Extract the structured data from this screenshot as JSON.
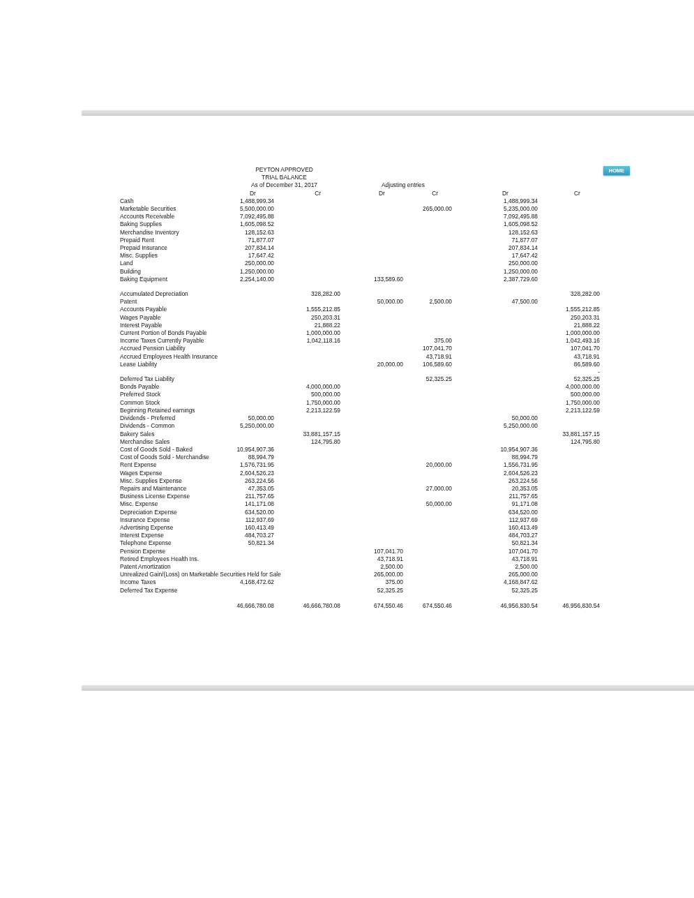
{
  "home_button": "HOME",
  "header": {
    "company": "PEYTON APPROVED",
    "title": "TRIAL BALANCE",
    "date": "As of December 31, 2017",
    "adjusting_heading": "Adjusting entries"
  },
  "column_headings": [
    "Dr",
    "Cr",
    "Dr",
    "Cr",
    "Dr",
    "Cr"
  ],
  "rows": [
    {
      "kind": "account",
      "label": "Cash",
      "dr": "1,488,999.34",
      "column_5": "1,488,999.34"
    },
    {
      "kind": "account",
      "label": "Marketable Securities",
      "dr": "5,500,000.00",
      "adj_cr": "265,000.00",
      "column_5": "5,235,000.00"
    },
    {
      "kind": "account",
      "label": "Accounts Receivable",
      "dr": "7,092,495.88",
      "column_5": "7,092,495.88"
    },
    {
      "kind": "account",
      "label": "Baking Supplies",
      "dr": "1,605,098.52",
      "column_5": "1,605,098.52"
    },
    {
      "kind": "account",
      "label": "Merchandise Inventory",
      "dr": "128,152.63",
      "column_5": "128,152.63"
    },
    {
      "kind": "account",
      "label": "Prepaid Rent",
      "dr": "71,877.07",
      "column_5": "71,877.07"
    },
    {
      "kind": "account",
      "label": "Prepaid Insurance",
      "dr": "207,834.14",
      "column_5": "207,834.14"
    },
    {
      "kind": "account",
      "label": "Misc. Supplies",
      "dr": "17,647.42",
      "column_5": "17,647.42"
    },
    {
      "kind": "account",
      "label": "Land",
      "dr": "250,000.00",
      "column_5": "250,000.00"
    },
    {
      "kind": "account",
      "label": "Building",
      "dr": "1,250,000.00",
      "column_5": "1,250,000.00"
    },
    {
      "kind": "account",
      "label": "Baking Equipment",
      "dr": "2,254,140.00",
      "adj_dr": "133,589.60",
      "column_5": "2,387,729.60"
    },
    {
      "kind": "spacer"
    },
    {
      "kind": "account",
      "label": "Accumulated Depreciation",
      "cr": "328,282.00",
      "column_6": "328,282.00"
    },
    {
      "kind": "account",
      "label": "Patent",
      "adj_dr": "50,000.00",
      "adj_cr": "2,500.00",
      "column_5": "47,500.00"
    },
    {
      "kind": "account",
      "label": "Accounts Payable",
      "cr": "1,555,212.85",
      "column_6": "1,555,212.85"
    },
    {
      "kind": "account",
      "label": "Wages Payable",
      "cr": "250,203.31",
      "column_6": "250,203.31"
    },
    {
      "kind": "account",
      "label": "Interest Payable",
      "cr": "21,888.22",
      "column_6": "21,888.22"
    },
    {
      "kind": "account",
      "label": "Current Portion of Bonds Payable",
      "cr": "1,000,000.00",
      "column_6": "1,000,000.00"
    },
    {
      "kind": "account",
      "label": "Income Taxes Currently Payable",
      "cr": "1,042,118.16",
      "adj_cr": "375.00",
      "column_6": "1,042,493.16"
    },
    {
      "kind": "account",
      "label": "Accrued Pension Liability",
      "adj_cr": "107,041.70",
      "column_6": "107,041.70"
    },
    {
      "kind": "account",
      "label": "Accrued Employees Health Insurance",
      "adj_cr": "43,718.91",
      "column_6": "43,718.91"
    },
    {
      "kind": "account",
      "label": "Lease Liability",
      "adj_dr": "20,000.00",
      "adj_cr": "106,589.60",
      "column_6": "86,589.60"
    },
    {
      "kind": "spacer",
      "column_6": "-"
    },
    {
      "kind": "account",
      "label": "Deferred Tax Liability",
      "adj_cr": "52,325.25",
      "column_6": "52,325.25"
    },
    {
      "kind": "account",
      "label": "Bonds Payable",
      "cr": "4,000,000.00",
      "column_6": "4,000,000.00"
    },
    {
      "kind": "account",
      "label": "Preferred Stock",
      "cr": "500,000.00",
      "column_6": "500,000.00"
    },
    {
      "kind": "account",
      "label": "Common Stock",
      "cr": "1,750,000.00",
      "column_6": "1,750,000.00"
    },
    {
      "kind": "account",
      "label": "Beginning Retained earnings",
      "cr": "2,213,122.59",
      "column_6": "2,213,122.59"
    },
    {
      "kind": "account",
      "label": "Dividends - Preferred",
      "dr": "50,000.00",
      "column_5": "50,000.00"
    },
    {
      "kind": "account",
      "label": "Dividends - Common",
      "dr": "5,250,000.00",
      "column_5": "5,250,000.00"
    },
    {
      "kind": "account",
      "label": "Bakery Sales",
      "cr": "33,881,157.15",
      "column_6": "33,881,157.15"
    },
    {
      "kind": "account",
      "label": "Merchandise Sales",
      "cr": "124,795.80",
      "column_6": "124,795.80"
    },
    {
      "kind": "account",
      "label": "Cost of Goods Sold - Baked",
      "dr": "10,954,907.36",
      "column_5": "10,954,907.36"
    },
    {
      "kind": "account",
      "label": "Cost of Goods Sold - Merchandise",
      "dr": "88,994.79",
      "column_5": "88,994.79"
    },
    {
      "kind": "account",
      "label": "Rent Expense",
      "dr": "1,576,731.95",
      "adj_cr": "20,000.00",
      "column_5": "1,556,731.95"
    },
    {
      "kind": "account",
      "label": "Wages Expense",
      "dr": "2,604,526.23",
      "column_5": "2,604,526.23"
    },
    {
      "kind": "account",
      "label": "Misc. Supplies Expense",
      "dr": "263,224.56",
      "column_5": "263,224.56"
    },
    {
      "kind": "account",
      "label": "Repairs and Maintenance",
      "dr": "47,353.05",
      "adj_cr": "27,000.00",
      "column_5": "20,353.05"
    },
    {
      "kind": "account",
      "label": "Business License Expense",
      "dr": "211,757.65",
      "column_5": "211,757.65"
    },
    {
      "kind": "account",
      "label": "Misc. Expense",
      "dr": "141,171.08",
      "adj_cr": "50,000.00",
      "column_5": "91,171.08"
    },
    {
      "kind": "account",
      "label": "Depreciation Expense",
      "dr": "634,520.00",
      "column_5": "634,520.00"
    },
    {
      "kind": "account",
      "label": "Insurance Expense",
      "dr": "112,937.69",
      "column_5": "112,937.69"
    },
    {
      "kind": "account",
      "label": "Advertising Expense",
      "dr": "160,413.49",
      "column_5": "160,413.49"
    },
    {
      "kind": "account",
      "label": "Interest Expense",
      "dr": "484,703.27",
      "column_5": "484,703.27"
    },
    {
      "kind": "account",
      "label": "Telephone Expense",
      "dr": "50,821.34",
      "column_5": "50,821.34"
    },
    {
      "kind": "account",
      "label": "Pension Expense",
      "adj_dr": "107,041.70",
      "column_5": "107,041.70"
    },
    {
      "kind": "account",
      "label": "Retired Employees Health Ins.",
      "adj_dr": "43,718.91",
      "column_5": "43,718.91"
    },
    {
      "kind": "account",
      "label": "Patent Amortization",
      "adj_dr": "2,500.00",
      "column_5": "2,500.00"
    },
    {
      "kind": "account",
      "label": "Unrealized Gain/(Loss) on Marketable Securities Held for Sale",
      "adj_dr": "265,000.00",
      "column_5": "265,000.00"
    },
    {
      "kind": "account",
      "label": "Income Taxes",
      "dr": "4,168,472.62",
      "adj_dr": "375.00",
      "column_5": "4,168,847.62"
    },
    {
      "kind": "account",
      "label": "Deferred Tax Expense",
      "adj_dr": "52,325.25",
      "column_5": "52,325.25"
    },
    {
      "kind": "total",
      "dr": "46,666,780.08",
      "cr": "46,666,780.08",
      "adj_dr": "674,550.46",
      "adj_cr": "674,550.46",
      "column_5": "46,956,830.54",
      "column_6": "46,956,830.54"
    }
  ]
}
